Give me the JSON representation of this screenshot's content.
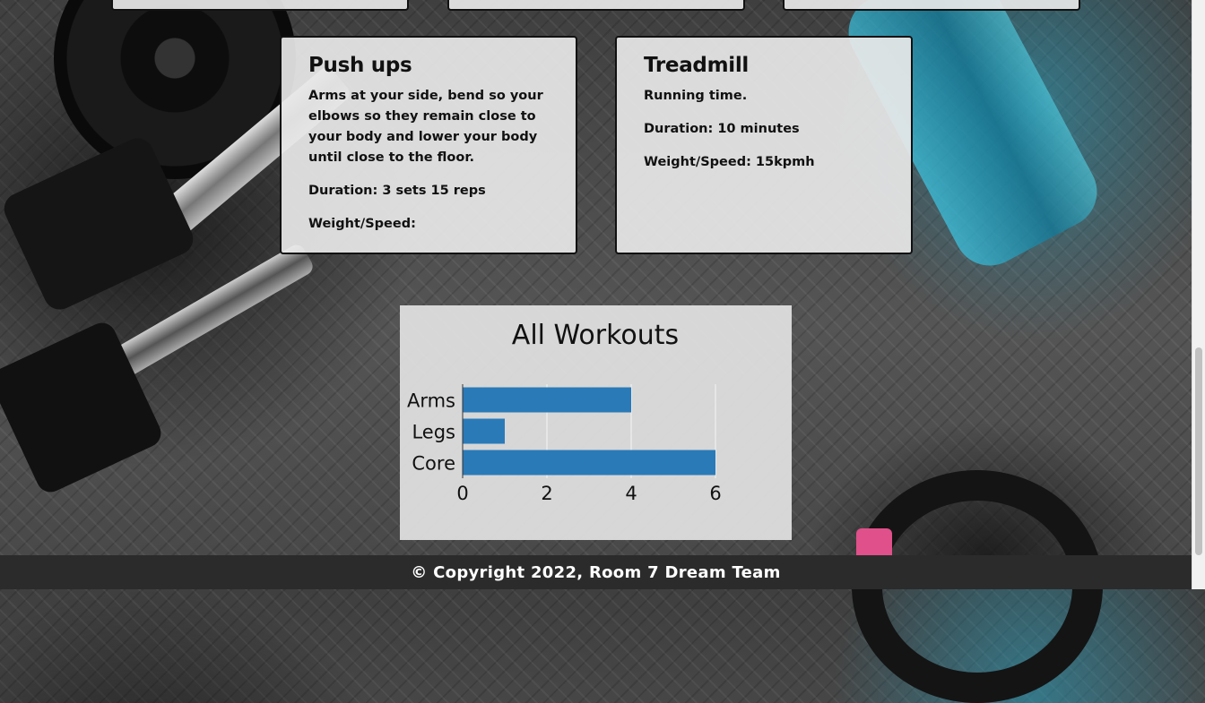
{
  "workouts": [
    {
      "title": "Push ups",
      "description": "Arms at your side, bend so your elbows so they remain close to your body and lower your body until close to the floor.",
      "duration": "Duration: 3 sets 15 reps",
      "weight": "Weight/Speed:"
    },
    {
      "title": "Treadmill",
      "description": "Running time.",
      "duration": "Duration: 10 minutes",
      "weight": "Weight/Speed: 15kpmh"
    }
  ],
  "chart_data": {
    "type": "bar",
    "orientation": "horizontal",
    "title": "All Workouts",
    "categories": [
      "Arms",
      "Legs",
      "Core"
    ],
    "values": [
      4,
      1,
      6
    ],
    "xlim": [
      0,
      6
    ],
    "xticks": [
      "0",
      "2",
      "4",
      "6"
    ],
    "xlabel": "",
    "ylabel": "",
    "grid": true,
    "bar_color": "#2a7ab8"
  },
  "footer": {
    "text": "© Copyright 2022, Room 7 Dream Team"
  }
}
